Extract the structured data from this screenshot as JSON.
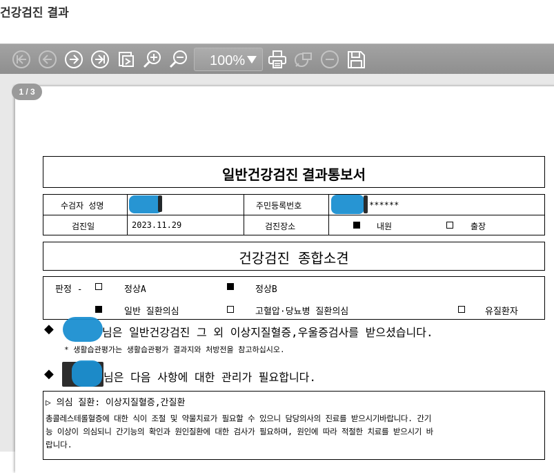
{
  "header": {
    "title": "건강검진 결과"
  },
  "toolbar": {
    "zoom": "100%",
    "buttons": [
      "first-page",
      "prev-page",
      "next-page",
      "last-page",
      "goto-page",
      "zoom-in",
      "zoom-out",
      "print",
      "export",
      "close",
      "save"
    ]
  },
  "viewer": {
    "page_indicator": "1 / 3"
  },
  "report": {
    "title": "일반건강검진 결과통보서",
    "name_label": "수검자 성명",
    "id_label": "주민등록번호",
    "id_value": "******",
    "date_label": "검진일",
    "date_value": "2023.11.29",
    "place_label": "검진장소",
    "place_options": [
      {
        "label": "내원",
        "checked": true
      },
      {
        "label": "출장",
        "checked": false
      }
    ],
    "summary_title": "건강검진 종합소견",
    "verdict_label": "판정 -",
    "verdicts": [
      {
        "label": "정상A",
        "checked": false
      },
      {
        "label": "정상B",
        "checked": true
      },
      {
        "label": "일반 질환의심",
        "checked": true
      },
      {
        "label": "고혈압·당뇨병 질환의심",
        "checked": false
      },
      {
        "label": "유질환자",
        "checked": false
      }
    ],
    "line1": "님은 일반건강검진 그 외 이상지질혈증,우울증검사를 받으셨습니다.",
    "line1_note": "* 생활습관평가는 생활습관평가 결과지와 처방전을 참고하십시오.",
    "line2": "님은 다음 사항에 대한 관리가 필요합니다.",
    "suspect_heading": "▷ 의심 질환: 이상지질혈증,간질환",
    "suspect_text_1": "총콜레스테롤혈증에 대한 식이 조절 및 약물치료가 필요할 수 있으니 담당의사의 진료를 받으시기바랍니다. 간기",
    "suspect_text_2": "능 이상이 의심되니 간기능의 확인과 원인질환에 대한 검사가 필요하며, 원인에 따라 적절한 치료를 받으시기 바",
    "suspect_text_3": "랍니다.",
    "bullet": "◆"
  },
  "colors": {
    "toolbar": "#999999",
    "redaction": "#1b8fd1",
    "page_bg": "#e8e8e8"
  }
}
